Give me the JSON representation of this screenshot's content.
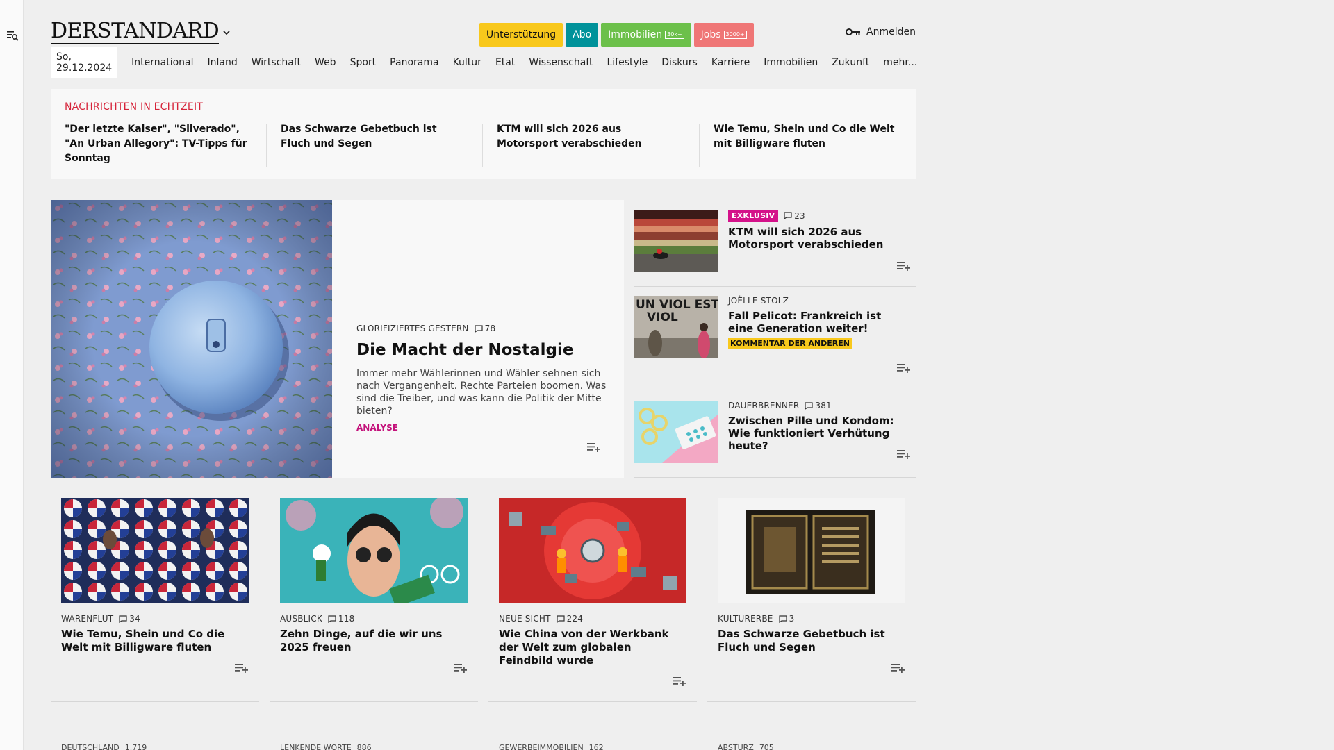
{
  "header": {
    "logo": "DERSTANDARD",
    "pills": [
      {
        "label": "Unterstützung",
        "bg": "#f8c81c",
        "fg": "#111",
        "badge": ""
      },
      {
        "label": "Abo",
        "bg": "#00929a",
        "fg": "#fff",
        "badge": ""
      },
      {
        "label": "Immobilien",
        "bg": "#6cc04a",
        "fg": "#fff",
        "badge": "30k+"
      },
      {
        "label": "Jobs",
        "bg": "#ef7676",
        "fg": "#fff",
        "badge": "3000+"
      }
    ],
    "login": "Anmelden"
  },
  "nav": {
    "date": "So, 29.12.2024",
    "items": [
      "International",
      "Inland",
      "Wirtschaft",
      "Web",
      "Sport",
      "Panorama",
      "Kultur",
      "Etat",
      "Wissenschaft",
      "Lifestyle",
      "Diskurs",
      "Karriere",
      "Immobilien",
      "Zukunft",
      "mehr..."
    ]
  },
  "ticker": {
    "label": "NACHRICHTEN IN ECHTZEIT",
    "items": [
      "\"Der letzte Kaiser\", \"Silverado\", \"An Urban Allegory\": TV-Tipps für Sonntag",
      "Das Schwarze Gebetbuch ist Fluch und Segen",
      "KTM will sich 2026 aus Motorsport verabschieden",
      "Wie Temu, Shein und Co die Welt mit Billigware fluten"
    ]
  },
  "hero": {
    "kicker": "GLORIFIZIERTES GESTERN",
    "comments": "78",
    "title": "Die Macht der Nostalgie",
    "teaser": "Immer mehr Wählerinnen und Wähler sehnen sich nach Vergangenheit. Rechte Parteien boomen. Was sind die Treiber, und was kann die Politik der Mitte bieten?",
    "label": "ANALYSE"
  },
  "side": [
    {
      "tag": "EXKLUSIV",
      "comments": "23",
      "title": "KTM will sich 2026 aus Motorsport verabschieden"
    },
    {
      "kicker": "JOËLLE STOLZ",
      "title": "Fall Pelicot: Frankreich ist eine Generation weiter!",
      "badge": "KOMMENTAR DER ANDEREN",
      "image_text": "UN VIOL EST UN VIOL"
    },
    {
      "kicker": "DAUERBRENNER",
      "comments": "381",
      "title": "Zwischen Pille und Kondom: Wie funktioniert Verhütung heute?"
    }
  ],
  "cards": [
    {
      "kicker": "WARENFLUT",
      "comments": "34",
      "title": "Wie Temu, Shein und Co die Welt mit Billigware fluten"
    },
    {
      "kicker": "AUSBLICK",
      "comments": "118",
      "title": "Zehn Dinge, auf die wir uns 2025 freuen"
    },
    {
      "kicker": "NEUE SICHT",
      "comments": "224",
      "title": "Wie China von der Werkbank der Welt zum globalen Feindbild wurde"
    },
    {
      "kicker": "KULTURERBE",
      "comments": "3",
      "title": "Das Schwarze Gebetbuch ist Fluch und Segen"
    }
  ],
  "peek": [
    {
      "kicker": "DEUTSCHLAND",
      "comments": "1.719"
    },
    {
      "kicker": "LENKENDE WORTE",
      "comments": "886"
    },
    {
      "kicker": "GEWERBEIMMOBILIEN",
      "comments": "162"
    },
    {
      "kicker": "ABSTURZ",
      "comments": "705"
    }
  ],
  "icons": [
    "menu-search-icon",
    "chevron-down-icon",
    "key-icon",
    "comment-icon",
    "playlist-add-icon"
  ],
  "colors": {
    "accent_red": "#d6243a",
    "magenta": "#c4127b",
    "yellow": "#f8c81c"
  }
}
